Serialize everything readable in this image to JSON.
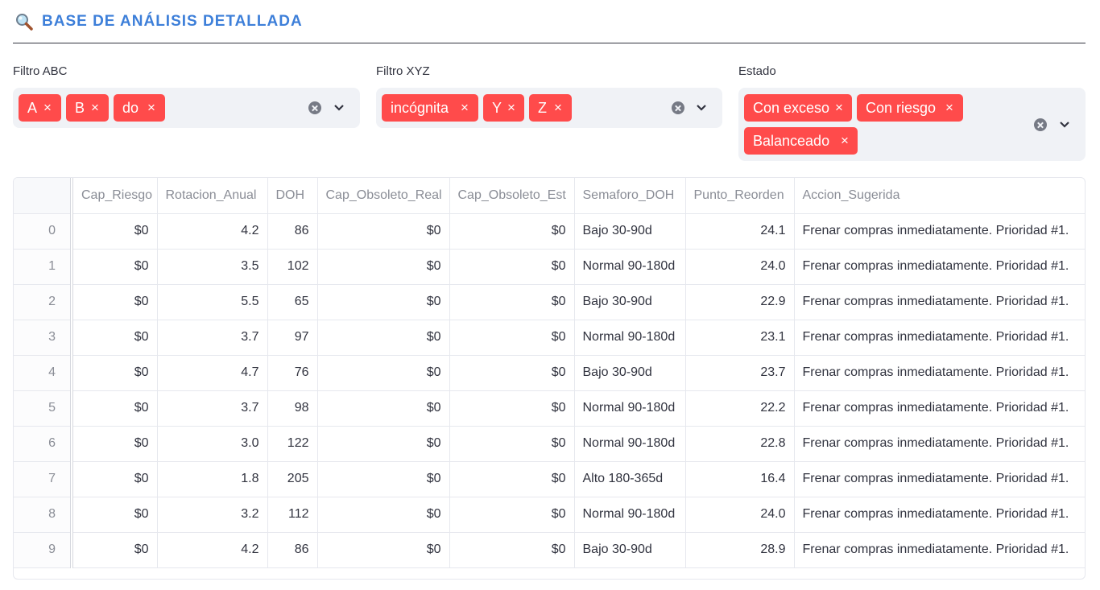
{
  "header": {
    "title": "BASE DE ANÁLISIS DETALLADA",
    "icon": "magnifier-icon"
  },
  "filters": [
    {
      "label": "Filtro ABC",
      "chips": [
        "A",
        "B",
        "do"
      ]
    },
    {
      "label": "Filtro XYZ",
      "chips": [
        "incógnita",
        "Y",
        "Z"
      ]
    },
    {
      "label": "Estado",
      "chips": [
        "Con exceso",
        "Con riesgo",
        "Balanceado"
      ]
    }
  ],
  "colors": {
    "chip": "#ff4b4b",
    "title": "#3d7fd9",
    "input_bg": "#f0f2f6"
  },
  "table": {
    "columns": [
      "",
      "Cap_Riesgo",
      "Rotacion_Anual",
      "DOH",
      "Cap_Obsoleto_Real",
      "Cap_Obsoleto_Est",
      "Semaforo_DOH",
      "Punto_Reorden",
      "Accion_Sugerida"
    ],
    "rows": [
      [
        "0",
        "$0",
        "4.2",
        "86",
        "$0",
        "$0",
        "Bajo 30-90d",
        "24.1",
        "Frenar compras inmediatamente. Prioridad #1."
      ],
      [
        "1",
        "$0",
        "3.5",
        "102",
        "$0",
        "$0",
        "Normal 90-180d",
        "24.0",
        "Frenar compras inmediatamente. Prioridad #1."
      ],
      [
        "2",
        "$0",
        "5.5",
        "65",
        "$0",
        "$0",
        "Bajo 30-90d",
        "22.9",
        "Frenar compras inmediatamente. Prioridad #1."
      ],
      [
        "3",
        "$0",
        "3.7",
        "97",
        "$0",
        "$0",
        "Normal 90-180d",
        "23.1",
        "Frenar compras inmediatamente. Prioridad #1."
      ],
      [
        "4",
        "$0",
        "4.7",
        "76",
        "$0",
        "$0",
        "Bajo 30-90d",
        "23.7",
        "Frenar compras inmediatamente. Prioridad #1."
      ],
      [
        "5",
        "$0",
        "3.7",
        "98",
        "$0",
        "$0",
        "Normal 90-180d",
        "22.2",
        "Frenar compras inmediatamente. Prioridad #1."
      ],
      [
        "6",
        "$0",
        "3.0",
        "122",
        "$0",
        "$0",
        "Normal 90-180d",
        "22.8",
        "Frenar compras inmediatamente. Prioridad #1."
      ],
      [
        "7",
        "$0",
        "1.8",
        "205",
        "$0",
        "$0",
        "Alto 180-365d",
        "16.4",
        "Frenar compras inmediatamente. Prioridad #1."
      ],
      [
        "8",
        "$0",
        "3.2",
        "112",
        "$0",
        "$0",
        "Normal 90-180d",
        "24.0",
        "Frenar compras inmediatamente. Prioridad #1."
      ],
      [
        "9",
        "$0",
        "4.2",
        "86",
        "$0",
        "$0",
        "Bajo 30-90d",
        "28.9",
        "Frenar compras inmediatamente. Prioridad #1."
      ]
    ]
  }
}
